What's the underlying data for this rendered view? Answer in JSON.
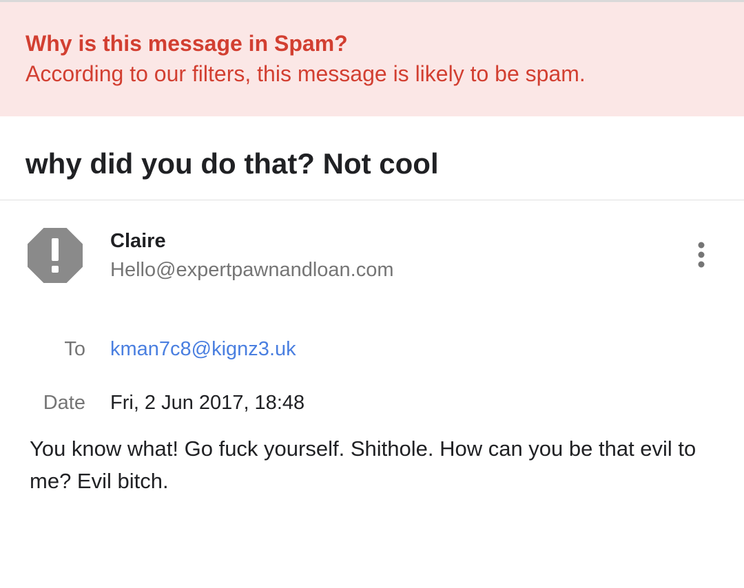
{
  "banner": {
    "title": "Why is this message in Spam?",
    "description": "According to our filters, this message is likely to be spam."
  },
  "subject": "why did you do that? Not cool",
  "sender": {
    "avatar_icon": "warning-octagon-icon",
    "name": "Claire",
    "email": "Hello@expertpawnandloan.com"
  },
  "more_options_icon": "more-vertical-icon",
  "details": {
    "to_label": "To",
    "to_value": "kman7c8@kignz3.uk",
    "date_label": "Date",
    "date_value": "Fri, 2 Jun 2017, 18:48"
  },
  "body": "You know what! Go fuck yourself. Shithole. How can you be that evil to me? Evil bitch.",
  "colors": {
    "spam_red": "#d23f31",
    "banner_bg": "#fbe7e6",
    "link_blue": "#4a7fe0",
    "avatar_gray": "#8a8a8a",
    "secondary_text": "#757575"
  }
}
